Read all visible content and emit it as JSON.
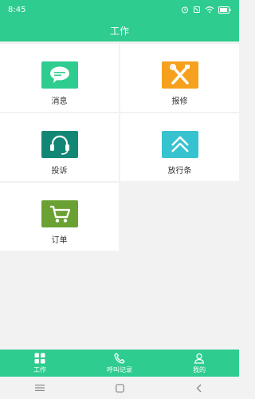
{
  "status_bar": {
    "time": "8:45",
    "icons": [
      "alarm-icon",
      "silent-icon",
      "wifi-icon",
      "battery-icon"
    ]
  },
  "header": {
    "title": "工作"
  },
  "tiles": [
    {
      "label": "消息",
      "icon": "message-icon",
      "color": "#2ecc8e"
    },
    {
      "label": "报修",
      "icon": "repair-tools-icon",
      "color": "#f5a11d"
    },
    {
      "label": "投诉",
      "icon": "headset-icon",
      "color": "#138775"
    },
    {
      "label": "放行条",
      "icon": "pass-up-icon",
      "color": "#36c3cf"
    },
    {
      "label": "订单",
      "icon": "cart-icon",
      "color": "#6ba132"
    }
  ],
  "bottom_nav": [
    {
      "label": "工作",
      "icon": "grid-icon"
    },
    {
      "label": "呼叫记录",
      "icon": "phone-icon"
    },
    {
      "label": "我的",
      "icon": "user-icon"
    }
  ],
  "system_nav": [
    "menu-icon",
    "home-icon",
    "back-icon"
  ],
  "colors": {
    "accent": "#2ecc8e",
    "background": "#f2f2f2"
  }
}
